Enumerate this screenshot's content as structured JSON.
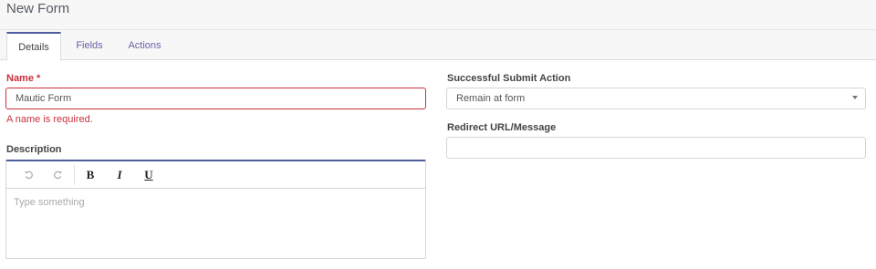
{
  "header": {
    "title": "New Form"
  },
  "tabs": [
    {
      "label": "Details",
      "active": true
    },
    {
      "label": "Fields",
      "active": false
    },
    {
      "label": "Actions",
      "active": false
    }
  ],
  "form": {
    "name": {
      "label": "Name",
      "required_marker": "*",
      "value": "Mautic Form",
      "error": "A name is required."
    },
    "description": {
      "label": "Description",
      "placeholder": "Type something",
      "toolbar": {
        "undo_icon": "undo-icon",
        "redo_icon": "redo-icon",
        "bold": "B",
        "italic": "I",
        "underline": "U"
      }
    },
    "submit_action": {
      "label": "Successful Submit Action",
      "value": "Remain at form"
    },
    "redirect": {
      "label": "Redirect URL/Message",
      "value": ""
    }
  },
  "colors": {
    "accent": "#4e5d9d",
    "tab_link": "#6a5fa8",
    "error": "#c9303c"
  }
}
